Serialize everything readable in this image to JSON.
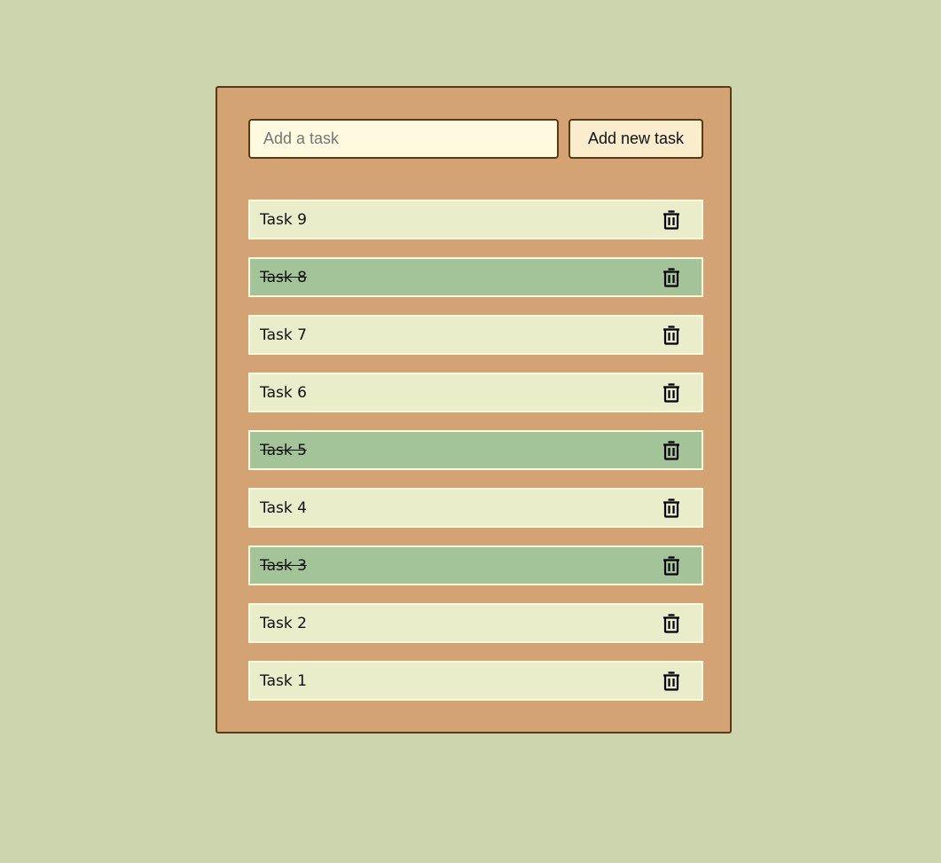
{
  "form": {
    "input_placeholder": "Add a task",
    "input_value": "",
    "add_button_label": "Add new task"
  },
  "tasks": [
    {
      "label": "Task 9",
      "done": false
    },
    {
      "label": "Task 8",
      "done": true
    },
    {
      "label": "Task 7",
      "done": false
    },
    {
      "label": "Task 6",
      "done": false
    },
    {
      "label": "Task 5",
      "done": true
    },
    {
      "label": "Task 4",
      "done": false
    },
    {
      "label": "Task 3",
      "done": true
    },
    {
      "label": "Task 2",
      "done": false
    },
    {
      "label": "Task 1",
      "done": false
    }
  ],
  "icons": {
    "delete": "trash-icon"
  },
  "colors": {
    "page_background": "#cdd5af",
    "card_background": "#d4a373",
    "task_background": "#e9edc9",
    "task_done_background": "#a3c499"
  }
}
